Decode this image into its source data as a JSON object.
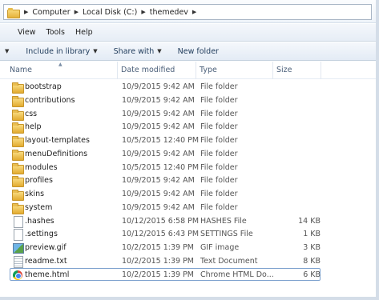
{
  "breadcrumb": [
    "Computer",
    "Local Disk (C:)",
    "themedev"
  ],
  "menu": [
    "View",
    "Tools",
    "Help"
  ],
  "toolbar": {
    "include_label": "Include in library",
    "share_label": "Share with",
    "new_folder_label": "New folder"
  },
  "columns": {
    "name": "Name",
    "date": "Date modified",
    "type": "Type",
    "size": "Size"
  },
  "files": [
    {
      "name": "bootstrap",
      "date": "10/9/2015 9:42 AM",
      "type": "File folder",
      "size": "",
      "icon": "folder-icon"
    },
    {
      "name": "contributions",
      "date": "10/9/2015 9:42 AM",
      "type": "File folder",
      "size": "",
      "icon": "folder-icon"
    },
    {
      "name": "css",
      "date": "10/9/2015 9:42 AM",
      "type": "File folder",
      "size": "",
      "icon": "folder-icon"
    },
    {
      "name": "help",
      "date": "10/9/2015 9:42 AM",
      "type": "File folder",
      "size": "",
      "icon": "folder-icon"
    },
    {
      "name": "layout-templates",
      "date": "10/5/2015 12:40 PM",
      "type": "File folder",
      "size": "",
      "icon": "folder-icon"
    },
    {
      "name": "menuDefinitions",
      "date": "10/9/2015 9:42 AM",
      "type": "File folder",
      "size": "",
      "icon": "folder-icon"
    },
    {
      "name": "modules",
      "date": "10/5/2015 12:40 PM",
      "type": "File folder",
      "size": "",
      "icon": "folder-icon"
    },
    {
      "name": "profiles",
      "date": "10/9/2015 9:42 AM",
      "type": "File folder",
      "size": "",
      "icon": "folder-icon"
    },
    {
      "name": "skins",
      "date": "10/9/2015 9:42 AM",
      "type": "File folder",
      "size": "",
      "icon": "folder-icon"
    },
    {
      "name": "system",
      "date": "10/9/2015 9:42 AM",
      "type": "File folder",
      "size": "",
      "icon": "folder-icon"
    },
    {
      "name": ".hashes",
      "date": "10/12/2015 6:58 PM",
      "type": "HASHES File",
      "size": "14 KB",
      "icon": "file-icon"
    },
    {
      "name": ".settings",
      "date": "10/12/2015 6:43 PM",
      "type": "SETTINGS File",
      "size": "1 KB",
      "icon": "file-icon"
    },
    {
      "name": "preview.gif",
      "date": "10/2/2015 1:39 PM",
      "type": "GIF image",
      "size": "3 KB",
      "icon": "image-icon"
    },
    {
      "name": "readme.txt",
      "date": "10/2/2015 1:39 PM",
      "type": "Text Document",
      "size": "8 KB",
      "icon": "text-document-icon"
    },
    {
      "name": "theme.html",
      "date": "10/2/2015 1:39 PM",
      "type": "Chrome HTML Do...",
      "size": "6 KB",
      "icon": "chrome-icon",
      "selected": true
    }
  ]
}
